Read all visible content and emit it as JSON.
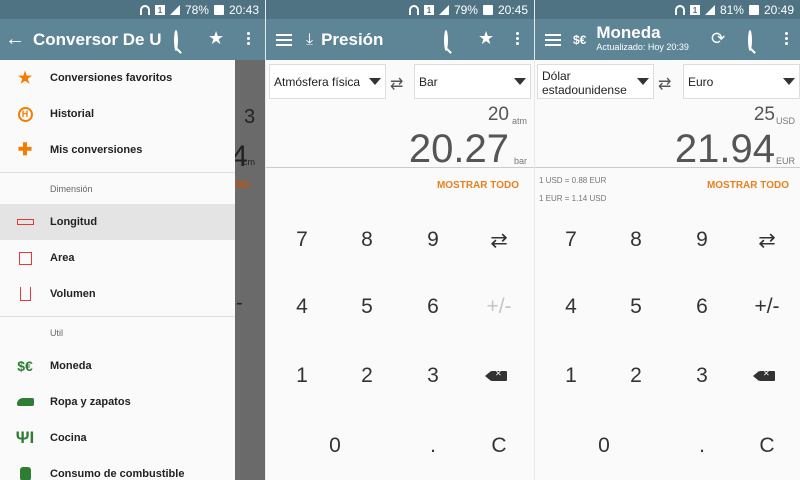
{
  "status_bars": [
    {
      "battery": "78%",
      "time": "20:43"
    },
    {
      "battery": "79%",
      "time": "20:45"
    },
    {
      "battery": "81%",
      "time": "20:49"
    }
  ],
  "panel1": {
    "title": "Conversor De Un...",
    "icons": {
      "back": "arrow-back-icon",
      "search": "search-icon",
      "favorite": "star-icon",
      "menu": "more-vert-icon"
    },
    "drawer": {
      "items_top": [
        {
          "label": "Conversiones favoritos",
          "icon": "star-icon"
        },
        {
          "label": "Historial",
          "icon": "history-icon"
        },
        {
          "label": "Mis conversiones",
          "icon": "puzzle-icon"
        }
      ],
      "section_dimension": "Dimensión",
      "items_dimension": [
        {
          "label": "Longitud",
          "icon": "ruler-icon"
        },
        {
          "label": "Area",
          "icon": "square-icon"
        },
        {
          "label": "Volumen",
          "icon": "beaker-icon"
        }
      ],
      "section_util": "Util",
      "items_util": [
        {
          "label": "Moneda",
          "icon": "currency-icon"
        },
        {
          "label": "Ropa y zapatos",
          "icon": "shoe-icon"
        },
        {
          "label": "Cocina",
          "icon": "cutlery-icon"
        },
        {
          "label": "Consumo de combustible",
          "icon": "fuel-icon"
        }
      ],
      "bg_peek": {
        "digit": "3",
        "value": "4",
        "unit": "cm",
        "show": "DO",
        "minus": "-"
      }
    }
  },
  "panel2": {
    "title": "Presión",
    "from_unit": "Atmósfera física",
    "to_unit": "Bar",
    "from_value": "20",
    "from_abbr": "atm",
    "to_value": "20.27",
    "to_abbr": "bar",
    "show_all": "MOSTRAR TODO",
    "keys": [
      "7",
      "8",
      "9",
      "4",
      "5",
      "6",
      "1",
      "2",
      "3",
      "0",
      ".",
      "C"
    ],
    "plus_minus": "+/-"
  },
  "panel3": {
    "title": "Moneda",
    "subtitle": "Actualizado: Hoy 20:39",
    "from_unit": "Dólar estadounidense",
    "to_unit": "Euro",
    "from_value": "25",
    "from_abbr": "USD",
    "to_value": "21.94",
    "to_abbr": "EUR",
    "rate1": "1 USD = 0.88 EUR",
    "rate2": "1 EUR = 1.14 USD",
    "show_all": "MOSTRAR TODO",
    "keys": [
      "7",
      "8",
      "9",
      "4",
      "5",
      "6",
      "1",
      "2",
      "3",
      "0",
      ".",
      "C"
    ],
    "plus_minus": "+/-"
  },
  "colors": {
    "appbar": "#5d8596",
    "statusbar": "#4f7383",
    "accent": "#e8801e",
    "drawer_orange": "#f57c00",
    "green": "#2e7d32"
  }
}
